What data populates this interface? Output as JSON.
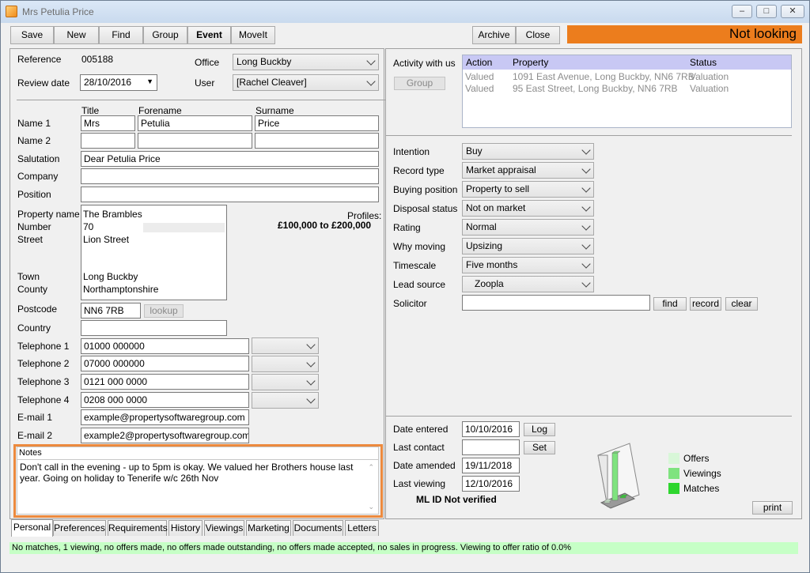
{
  "window": {
    "title": "Mrs Petulia Price",
    "min_icon": "minimize-icon",
    "max_icon": "maximize-icon",
    "close_icon": "close-icon"
  },
  "toolbar": {
    "save": "Save",
    "new": "New",
    "find": "Find",
    "group": "Group",
    "event": "Event",
    "moveit": "MoveIt",
    "archive": "Archive",
    "close": "Close",
    "status": "Not looking",
    "status_color": "#ec7d1d"
  },
  "record": {
    "reference_label": "Reference",
    "reference": "005188",
    "review_date_label": "Review date",
    "review_date": "28/10/2016",
    "office_label": "Office",
    "office": "Long Buckby",
    "user_label": "User",
    "user": "[Rachel Cleaver]"
  },
  "names": {
    "title_header": "Title",
    "forename_header": "Forename",
    "surname_header": "Surname",
    "name1_label": "Name 1",
    "name1_title": "Mrs",
    "name1_forename": "Petulia",
    "name1_surname": "Price",
    "name2_label": "Name 2",
    "name2_title": "",
    "name2_forename": "",
    "name2_surname": "",
    "salutation_label": "Salutation",
    "salutation": "Dear Petulia Price",
    "company_label": "Company",
    "company": "",
    "position_label": "Position",
    "position": ""
  },
  "address": {
    "property_name_label": "Property name",
    "number_label": "Number",
    "street_label": "Street",
    "town_label": "Town",
    "county_label": "County",
    "property_name": "The Brambles",
    "number": "70",
    "street": "Lion Street",
    "town": "Long Buckby",
    "county": "Northamptonshire",
    "postcode_label": "Postcode",
    "postcode": "NN6 7RB",
    "lookup": "lookup",
    "country_label": "Country",
    "country": ""
  },
  "profiles": {
    "label": "Profiles:",
    "range": "£100,000 to £200,000"
  },
  "contacts": {
    "tel1_label": "Telephone 1",
    "tel1": "01000 000000",
    "tel2_label": "Telephone 2",
    "tel2": "07000 000000",
    "tel3_label": "Telephone 3",
    "tel3": "0121 000 0000",
    "tel4_label": "Telephone 4",
    "tel4": "0208 000 0000",
    "email1_label": "E-mail 1",
    "email1": "example@propertysoftwaregroup.com",
    "email2_label": "E-mail 2",
    "email2": "example2@propertysoftwaregroup.com"
  },
  "notes": {
    "label": "Notes",
    "text": "Don't call in the evening - up to 5pm is okay. We valued her Brothers house last year. Going on holiday to Tenerife w/c 26th Nov"
  },
  "activity": {
    "label": "Activity with us",
    "group_button": "Group",
    "columns": [
      "Action",
      "Property",
      "Status"
    ],
    "rows": [
      [
        "Valued",
        "1091 East Avenue, Long Buckby, NN6 7RB",
        "Valuation"
      ],
      [
        "Valued",
        "95 East Street, Long Buckby, NN6 7RB",
        "Valuation"
      ]
    ]
  },
  "requirements": {
    "intention_label": "Intention",
    "intention": "Buy",
    "record_type_label": "Record type",
    "record_type": "Market appraisal",
    "buying_position_label": "Buying position",
    "buying_position": "Property to sell",
    "disposal_status_label": "Disposal status",
    "disposal_status": "Not on market",
    "rating_label": "Rating",
    "rating": "Normal",
    "why_moving_label": "Why moving",
    "why_moving": "Upsizing",
    "timescale_label": "Timescale",
    "timescale": "Five months",
    "lead_source_label": "Lead source",
    "lead_source": "Zoopla",
    "solicitor_label": "Solicitor",
    "solicitor": "",
    "find": "find",
    "record": "record",
    "clear": "clear"
  },
  "dates": {
    "date_entered_label": "Date entered",
    "date_entered": "10/10/2016",
    "log": "Log",
    "last_contact_label": "Last contact",
    "last_contact": "",
    "set": "Set",
    "date_amended_label": "Date amended",
    "date_amended": "19/11/2018",
    "last_viewing_label": "Last viewing",
    "last_viewing": "12/10/2016",
    "ml_id": "ML ID Not verified",
    "print": "print"
  },
  "chart_data": {
    "type": "bar",
    "categories": [
      "Offers",
      "Viewings",
      "Matches"
    ],
    "values": [
      0,
      1,
      0
    ],
    "legend": [
      {
        "name": "Offers",
        "color": "#d8f7d8"
      },
      {
        "name": "Viewings",
        "color": "#7fe37f"
      },
      {
        "name": "Matches",
        "color": "#2ed62e"
      }
    ]
  },
  "tabs": [
    "Personal",
    "Preferences",
    "Requirements",
    "History",
    "Viewings",
    "Marketing",
    "Documents",
    "Letters"
  ],
  "footer": {
    "text": "No matches, 1 viewing, no offers made, no offers made outstanding, no offers made accepted, no sales in progress.   Viewing to offer ratio of 0.0%"
  }
}
